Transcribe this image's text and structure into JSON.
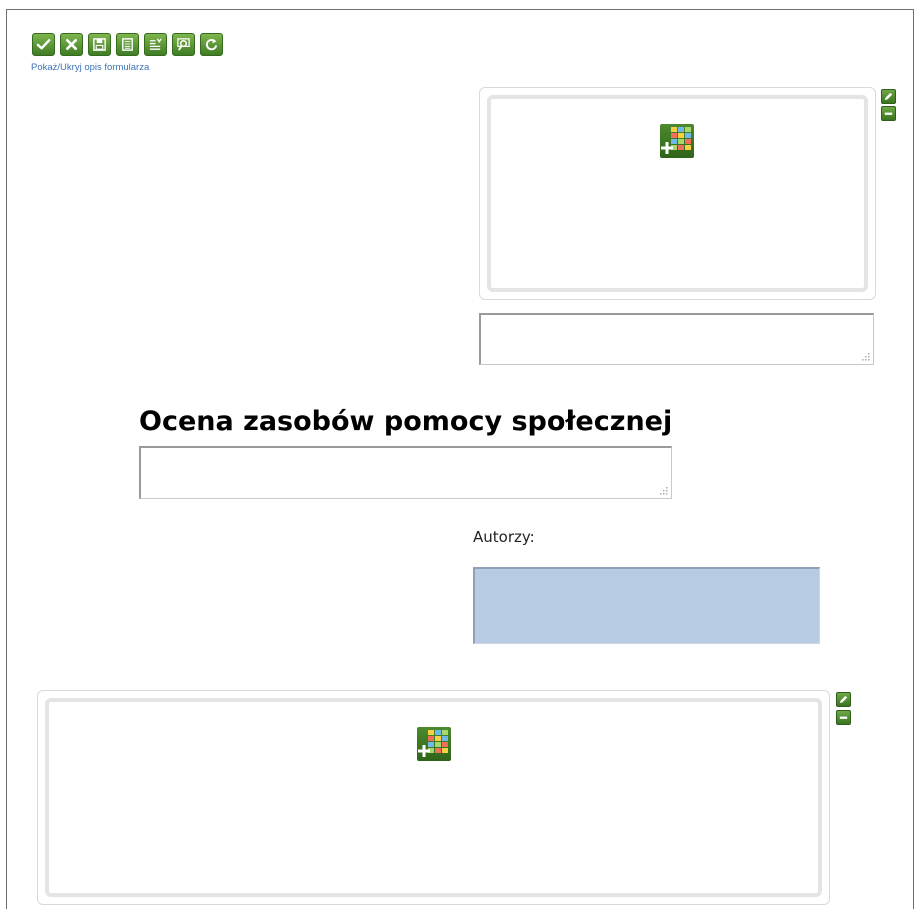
{
  "toolbar": {
    "buttons": [
      {
        "name": "accept",
        "icon": "check-icon"
      },
      {
        "name": "cancel",
        "icon": "x-icon"
      },
      {
        "name": "save",
        "icon": "floppy-disk-icon"
      },
      {
        "name": "save-as",
        "icon": "document-list-icon"
      },
      {
        "name": "export",
        "icon": "document-arrow-icon"
      },
      {
        "name": "preview",
        "icon": "magnifier-icon"
      },
      {
        "name": "refresh",
        "icon": "refresh-icon"
      }
    ],
    "toggle_description_link": "Pokaż/Ukryj opis formularza"
  },
  "top_panel": {
    "add_table_icon": "add-table-icon"
  },
  "top_text_area": {
    "value": ""
  },
  "heading": {
    "title": "Ocena zasobów pomocy społecznej"
  },
  "title_text_area": {
    "value": ""
  },
  "authors": {
    "label": "Autorzy:",
    "value": ""
  },
  "bottom_panel": {
    "add_table_icon": "add-table-icon"
  },
  "colors": {
    "button_green": "#4f8f2c",
    "link_blue": "#3b73b9",
    "authors_box_bg": "#b7cbe3",
    "panel_border": "#e4e4e4"
  }
}
